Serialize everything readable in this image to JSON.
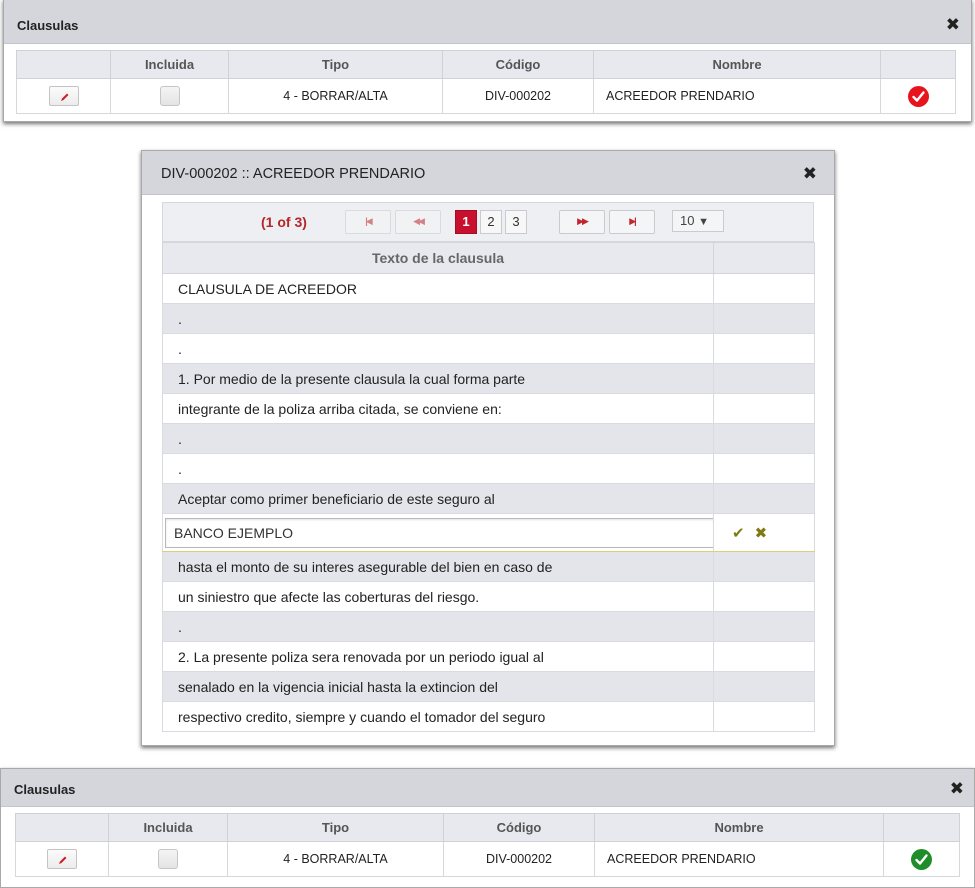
{
  "top_panel": {
    "title": "Clausulas",
    "columns": [
      "",
      "Incluida",
      "Tipo",
      "Código",
      "Nombre",
      ""
    ],
    "row": {
      "tipo": "4 - BORRAR/ALTA",
      "codigo": "DIV-000202",
      "nombre": "ACREEDOR PRENDARIO",
      "status_color": "#e8141d"
    }
  },
  "modal": {
    "title": "DIV-000202 :: ACREEDOR PRENDARIO",
    "pager": {
      "count": "(1 of 3)",
      "pages": [
        "1",
        "2",
        "3"
      ],
      "current_page": "1",
      "page_size": "10",
      "first_icon": "first-page-icon",
      "prev_icon": "prev-page-icon",
      "next_icon": "next-page-icon",
      "last_icon": "last-page-icon"
    },
    "table": {
      "header": "Texto de la clausula",
      "rows": [
        "CLAUSULA DE ACREEDOR",
        ".",
        ".",
        "1. Por medio de la presente clausula la cual forma parte",
        "integrante de la poliza arriba citada, se conviene en:",
        ".",
        ".",
        "Aceptar como primer beneficiario de este seguro al",
        "BANCO EJEMPLO",
        "hasta el monto de su interes asegurable del bien en caso de",
        "un siniestro que afecte las coberturas del riesgo.",
        ".",
        "2. La presente poliza sera renovada por un periodo igual al",
        "senalado en la vigencia inicial hasta la extincion del",
        "respectivo credito, siempre y cuando el tomador del seguro"
      ],
      "editing_value": "BANCO EJEMPLO",
      "save_icon": "check-icon",
      "cancel_icon": "close-icon"
    }
  },
  "bottom_panel": {
    "title": "Clausulas",
    "columns": [
      "",
      "Incluida",
      "Tipo",
      "Código",
      "Nombre",
      ""
    ],
    "row": {
      "tipo": "4 - BORRAR/ALTA",
      "codigo": "DIV-000202",
      "nombre": "ACREEDOR PRENDARIO",
      "status_color": "#1f8e2a"
    }
  },
  "colors": {
    "accent_red": "#c8102e",
    "header_bg": "#d4d6dc",
    "edit_row_border": "#d9d07a"
  }
}
